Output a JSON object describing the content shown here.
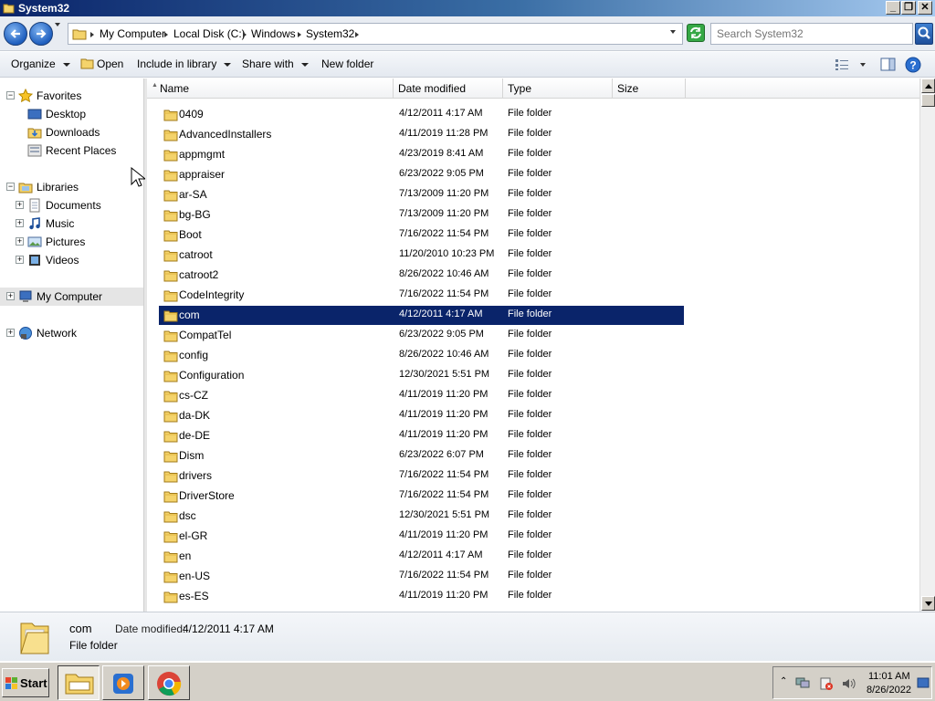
{
  "window": {
    "title": "System32"
  },
  "address": {
    "crumbs": [
      "My Computer",
      "Local Disk (C:)",
      "Windows",
      "System32"
    ],
    "search_placeholder": "Search System32"
  },
  "toolbar": {
    "organize": "Organize",
    "open": "Open",
    "include": "Include in library",
    "share": "Share with",
    "new_folder": "New folder"
  },
  "nav": {
    "favorites": "Favorites",
    "desktop": "Desktop",
    "downloads": "Downloads",
    "recent": "Recent Places",
    "libraries": "Libraries",
    "documents": "Documents",
    "music": "Music",
    "pictures": "Pictures",
    "videos": "Videos",
    "computer": "My Computer",
    "network": "Network"
  },
  "columns": {
    "name": "Name",
    "date": "Date modified",
    "type": "Type",
    "size": "Size"
  },
  "files": [
    {
      "name": "0409",
      "date": "4/12/2011 4:17 AM",
      "type": "File folder"
    },
    {
      "name": "AdvancedInstallers",
      "date": "4/11/2019 11:28 PM",
      "type": "File folder"
    },
    {
      "name": "appmgmt",
      "date": "4/23/2019 8:41 AM",
      "type": "File folder"
    },
    {
      "name": "appraiser",
      "date": "6/23/2022 9:05 PM",
      "type": "File folder"
    },
    {
      "name": "ar-SA",
      "date": "7/13/2009 11:20 PM",
      "type": "File folder"
    },
    {
      "name": "bg-BG",
      "date": "7/13/2009 11:20 PM",
      "type": "File folder"
    },
    {
      "name": "Boot",
      "date": "7/16/2022 11:54 PM",
      "type": "File folder"
    },
    {
      "name": "catroot",
      "date": "11/20/2010 10:23 PM",
      "type": "File folder"
    },
    {
      "name": "catroot2",
      "date": "8/26/2022 10:46 AM",
      "type": "File folder"
    },
    {
      "name": "CodeIntegrity",
      "date": "7/16/2022 11:54 PM",
      "type": "File folder"
    },
    {
      "name": "com",
      "date": "4/12/2011 4:17 AM",
      "type": "File folder"
    },
    {
      "name": "CompatTel",
      "date": "6/23/2022 9:05 PM",
      "type": "File folder"
    },
    {
      "name": "config",
      "date": "8/26/2022 10:46 AM",
      "type": "File folder"
    },
    {
      "name": "Configuration",
      "date": "12/30/2021 5:51 PM",
      "type": "File folder"
    },
    {
      "name": "cs-CZ",
      "date": "4/11/2019 11:20 PM",
      "type": "File folder"
    },
    {
      "name": "da-DK",
      "date": "4/11/2019 11:20 PM",
      "type": "File folder"
    },
    {
      "name": "de-DE",
      "date": "4/11/2019 11:20 PM",
      "type": "File folder"
    },
    {
      "name": "Dism",
      "date": "6/23/2022 6:07 PM",
      "type": "File folder"
    },
    {
      "name": "drivers",
      "date": "7/16/2022 11:54 PM",
      "type": "File folder"
    },
    {
      "name": "DriverStore",
      "date": "7/16/2022 11:54 PM",
      "type": "File folder"
    },
    {
      "name": "dsc",
      "date": "12/30/2021 5:51 PM",
      "type": "File folder"
    },
    {
      "name": "el-GR",
      "date": "4/11/2019 11:20 PM",
      "type": "File folder"
    },
    {
      "name": "en",
      "date": "4/12/2011 4:17 AM",
      "type": "File folder"
    },
    {
      "name": "en-US",
      "date": "7/16/2022 11:54 PM",
      "type": "File folder"
    },
    {
      "name": "es-ES",
      "date": "4/11/2019 11:20 PM",
      "type": "File folder"
    }
  ],
  "selected_file": "com",
  "details": {
    "name": "com",
    "modified_label": "Date modified:",
    "modified_value": "4/12/2011 4:17 AM",
    "type": "File folder"
  },
  "taskbar": {
    "start": "Start",
    "time": "11:01 AM",
    "date": "8/26/2022"
  },
  "colors": {
    "selection": "#0a246a",
    "taskbar": "#d4d0c8"
  }
}
